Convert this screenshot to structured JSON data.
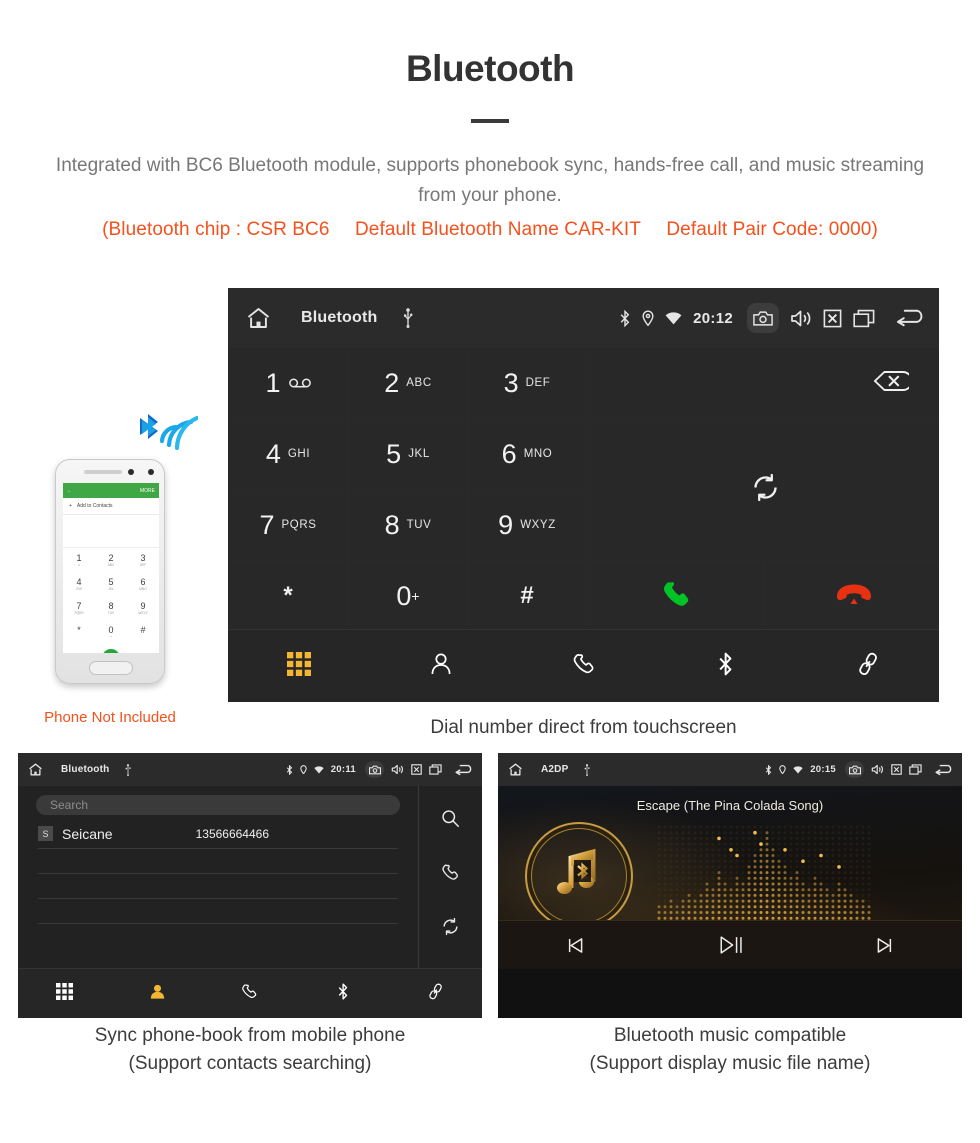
{
  "header": {
    "title": "Bluetooth",
    "intro": "Integrated with BC6 Bluetooth module, supports phonebook sync, hands-free call, and music streaming from your phone.",
    "specs": [
      "(Bluetooth chip : CSR BC6",
      "Default Bluetooth Name CAR-KIT",
      "Default Pair Code: 0000)"
    ],
    "accent_color": "#f4511e",
    "title_color": "#333333",
    "intro_color": "#777777"
  },
  "main_screen": {
    "statusbar": {
      "home_icon": "home-icon",
      "title": "Bluetooth",
      "usb_icon": "usb-icon",
      "bluetooth_icon": "bluetooth-icon",
      "location_icon": "location-icon",
      "wifi_icon": "wifi-icon",
      "time": "20:12",
      "camera_icon": "camera-icon",
      "volume_icon": "volume-icon",
      "close_icon": "close-box-icon",
      "recents_icon": "recents-icon",
      "back_icon": "back-icon"
    },
    "keys": [
      {
        "num": "1",
        "sub": "∞",
        "sub_type": "voicemail"
      },
      {
        "num": "2",
        "sub": "ABC"
      },
      {
        "num": "3",
        "sub": "DEF"
      },
      {
        "num": "4",
        "sub": "GHI"
      },
      {
        "num": "5",
        "sub": "JKL"
      },
      {
        "num": "6",
        "sub": "MNO"
      },
      {
        "num": "7",
        "sub": "PQRS"
      },
      {
        "num": "8",
        "sub": "TUV"
      },
      {
        "num": "9",
        "sub": "WXYZ"
      },
      {
        "num": "*",
        "sub": ""
      },
      {
        "num": "0",
        "sub": "+"
      },
      {
        "num": "#",
        "sub": ""
      }
    ],
    "backspace_icon": "backspace-icon",
    "sync_icon": "sync-icon",
    "call_icon": "call-icon",
    "hangup_icon": "hangup-icon",
    "call_color": "#00c425",
    "hangup_color": "#e63212",
    "navbar": [
      {
        "icon": "dialpad-icon",
        "active": true
      },
      {
        "icon": "contacts-icon",
        "active": false
      },
      {
        "icon": "call-log-icon",
        "active": false
      },
      {
        "icon": "bluetooth-icon",
        "active": false
      },
      {
        "icon": "link-icon",
        "active": false
      }
    ],
    "active_color": "#f2b632",
    "caption": "Dial number direct from touchscreen"
  },
  "phone_mockup": {
    "appbar_back_icon": "back-arrow-icon",
    "appbar_more": "MORE",
    "add_contact_label": "Add to Contacts",
    "add_icon": "plus-icon",
    "keys": [
      {
        "num": "1",
        "sub": "∞"
      },
      {
        "num": "2",
        "sub": "ABC"
      },
      {
        "num": "3",
        "sub": "DEF"
      },
      {
        "num": "4",
        "sub": "GHI"
      },
      {
        "num": "5",
        "sub": "JKL"
      },
      {
        "num": "6",
        "sub": "MNO"
      },
      {
        "num": "7",
        "sub": "PQRS"
      },
      {
        "num": "8",
        "sub": "TUV"
      },
      {
        "num": "9",
        "sub": "WXYZ"
      },
      {
        "num": "*",
        "sub": ""
      },
      {
        "num": "0",
        "sub": "+"
      },
      {
        "num": "#",
        "sub": ""
      }
    ],
    "video_call_icon": "video-call-icon",
    "call_icon": "call-icon",
    "keyboard_icon": "keyboard-icon",
    "bluetooth_signal_icon": "bluetooth-signal-icon",
    "not_included_label": "Phone Not Included",
    "not_included_color": "#f4511e",
    "green": "#3fa844"
  },
  "contacts_screen": {
    "statusbar": {
      "title": "Bluetooth",
      "time": "20:11"
    },
    "search_placeholder": "Search",
    "contacts": [
      {
        "initial": "S",
        "name": "Seicane",
        "number": "13566664466"
      }
    ],
    "side_icons": [
      "search-icon",
      "call-icon",
      "sync-icon"
    ],
    "navbar": [
      {
        "icon": "dialpad-icon",
        "active": false
      },
      {
        "icon": "contacts-icon",
        "active": true
      },
      {
        "icon": "call-log-icon",
        "active": false
      },
      {
        "icon": "bluetooth-icon",
        "active": false
      },
      {
        "icon": "link-icon",
        "active": false
      }
    ],
    "caption_line1": "Sync phone-book from mobile phone",
    "caption_line2": "(Support contacts searching)"
  },
  "music_screen": {
    "statusbar": {
      "title": "A2DP",
      "time": "20:15"
    },
    "song_title": "Escape (The Pina Colada Song)",
    "album_art_icon": "music-note-bluetooth-icon",
    "visualizer_icon": "dot-matrix-spectrum",
    "controls": [
      {
        "icon": "previous-track-icon"
      },
      {
        "icon": "play-pause-icon"
      },
      {
        "icon": "next-track-icon"
      }
    ],
    "gold_color": "#d9a441",
    "caption_line1": "Bluetooth music compatible",
    "caption_line2": "(Support display music file name)"
  }
}
